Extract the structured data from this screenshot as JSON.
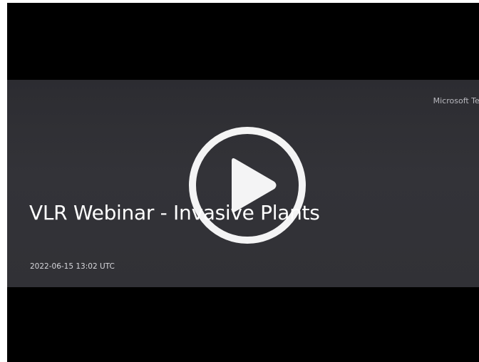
{
  "video": {
    "brand": "Microsoft Teams",
    "title": "VLR Webinar - Invasive Plants",
    "date": "2022-06-15 13:02 UTC",
    "play_icon": "play-icon"
  },
  "colors": {
    "letterbox": "#000000",
    "poster_background": "#313136",
    "title_text": "#ffffff",
    "play_icon": "#ffffff"
  }
}
